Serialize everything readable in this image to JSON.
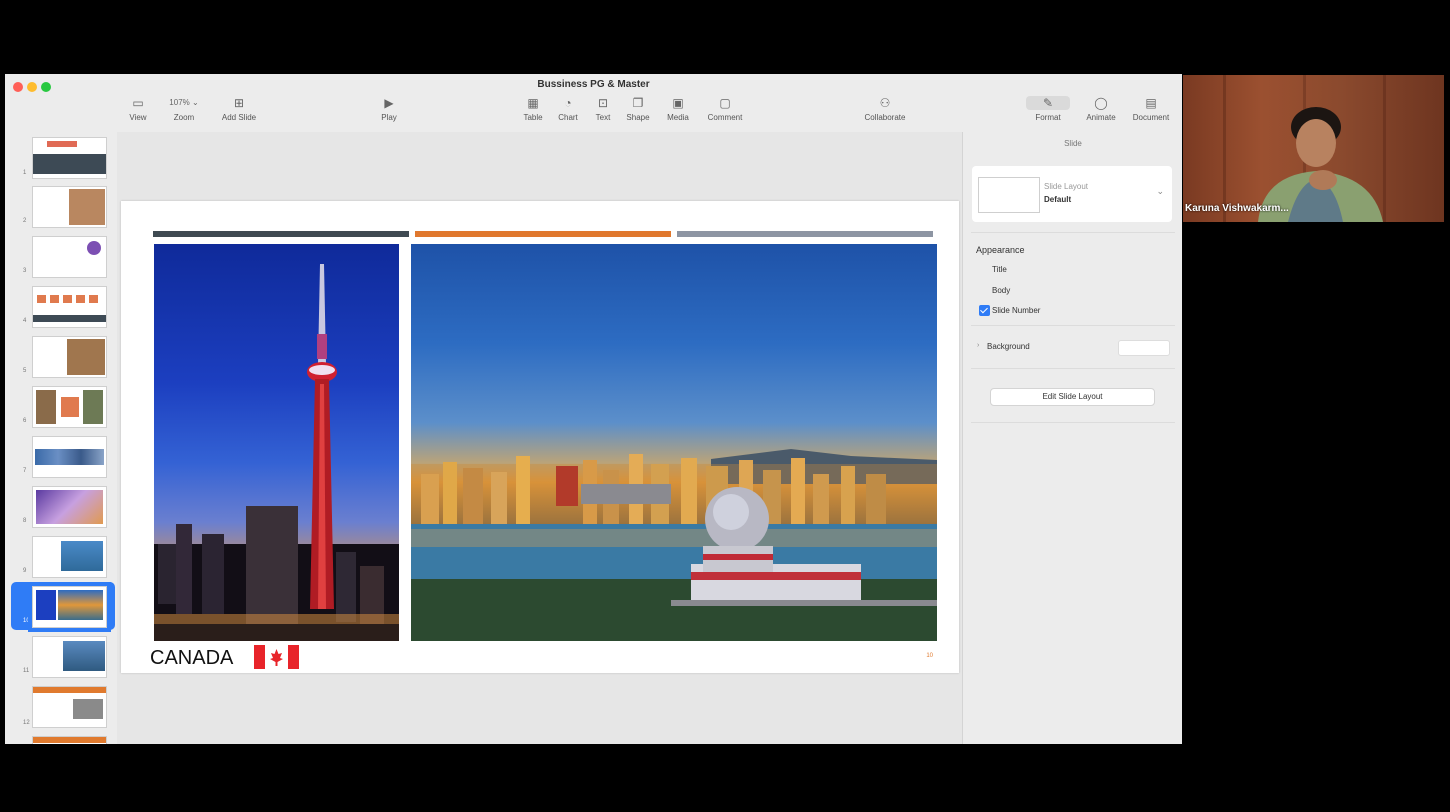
{
  "window": {
    "title": "Bussiness PG & Master"
  },
  "toolbar": {
    "view": "View",
    "zoom_value": "107% ⌄",
    "zoom": "Zoom",
    "add_slide": "Add Slide",
    "play": "Play",
    "table": "Table",
    "chart": "Chart",
    "text": "Text",
    "shape": "Shape",
    "media": "Media",
    "comment": "Comment",
    "collaborate": "Collaborate",
    "format": "Format",
    "animate": "Animate",
    "document": "Document"
  },
  "navigator": {
    "slide_numbers": [
      "1",
      "2",
      "3",
      "4",
      "5",
      "6",
      "7",
      "8",
      "9",
      "10",
      "11",
      "12"
    ],
    "selected_index": 10
  },
  "slide": {
    "country_label": "CANADA",
    "slide_number": "10",
    "colors": {
      "bar_dark": "#3f4a52",
      "bar_orange": "#e0782e",
      "bar_gray": "#8d95a3",
      "flag_red": "#e8242a"
    }
  },
  "inspector": {
    "tab": "Slide",
    "layout_label": "Slide Layout",
    "layout_value": "Default",
    "appearance": "Appearance",
    "title_option": "Title",
    "body_option": "Body",
    "slide_number_option": "Slide Number",
    "slide_number_checked": true,
    "background": "Background",
    "edit_layout_button": "Edit Slide Layout"
  },
  "participant": {
    "name": "Karuna Vishwakarm..."
  }
}
